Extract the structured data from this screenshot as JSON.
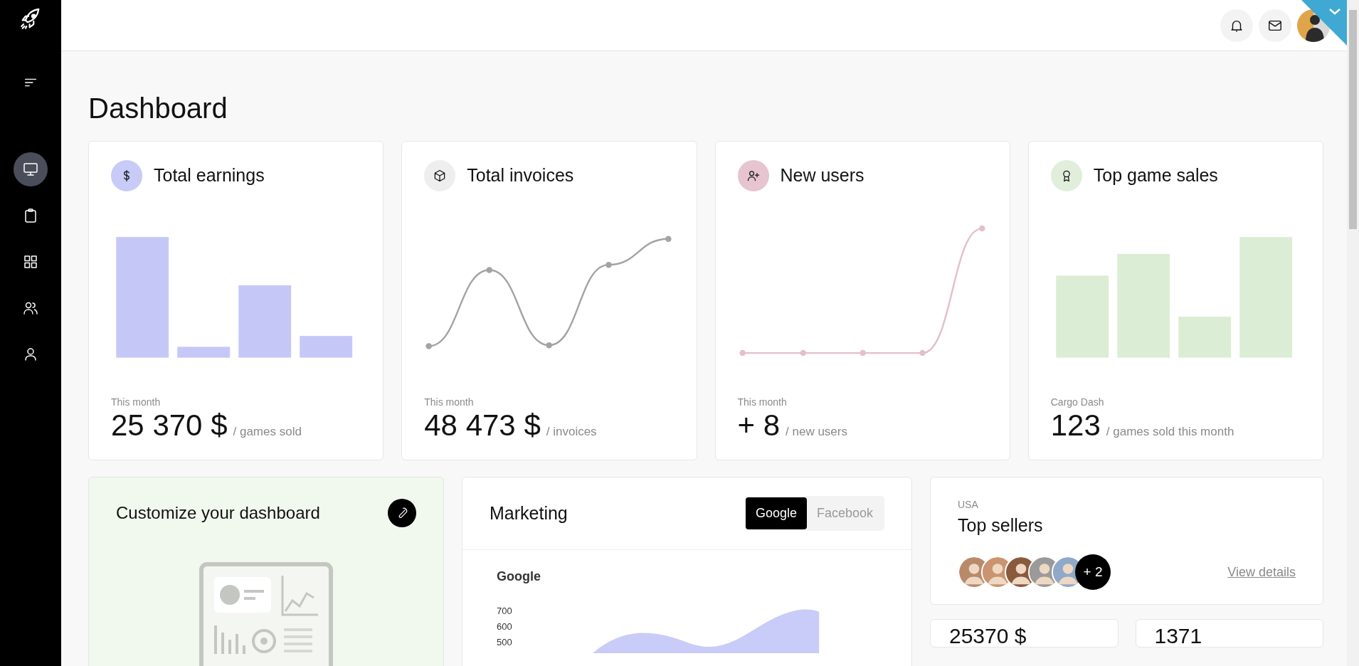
{
  "sidebar": {
    "nav_items": [
      {
        "selected": true
      },
      {
        "selected": false
      },
      {
        "selected": false
      },
      {
        "selected": false
      },
      {
        "selected": false
      }
    ]
  },
  "page_title": "Dashboard",
  "stat_cards": [
    {
      "title": "Total earnings",
      "kind": "bars",
      "color": "#c5c8f7",
      "caption": "This month",
      "value": "25 370 $",
      "unit": "/ games sold"
    },
    {
      "title": "Total invoices",
      "kind": "line",
      "color": "#a3a3a3",
      "caption": "This month",
      "value": "48 473 $",
      "unit": "/ invoices"
    },
    {
      "title": "New users",
      "kind": "line",
      "color": "#e3c0cb",
      "caption": "This month",
      "value": "+ 8",
      "unit": "/ new users"
    },
    {
      "title": "Top game sales",
      "kind": "bars",
      "color": "#dcedd5",
      "caption": "Cargo Dash",
      "value": "123",
      "unit": "/ games sold this month"
    }
  ],
  "customize": {
    "title": "Customize your dashboard"
  },
  "marketing": {
    "title": "Marketing",
    "tabs": [
      {
        "label": "Google",
        "selected": true
      },
      {
        "label": "Facebook",
        "selected": false
      }
    ],
    "chart_title": "Google",
    "y_tick_labels": [
      "700",
      "600",
      "500"
    ]
  },
  "top_sellers": {
    "region": "USA",
    "title": "Top sellers",
    "more_count": "+ 2",
    "link": "View details"
  },
  "mini_stats": [
    {
      "value": "25370 $"
    },
    {
      "value": "1371"
    }
  ]
}
